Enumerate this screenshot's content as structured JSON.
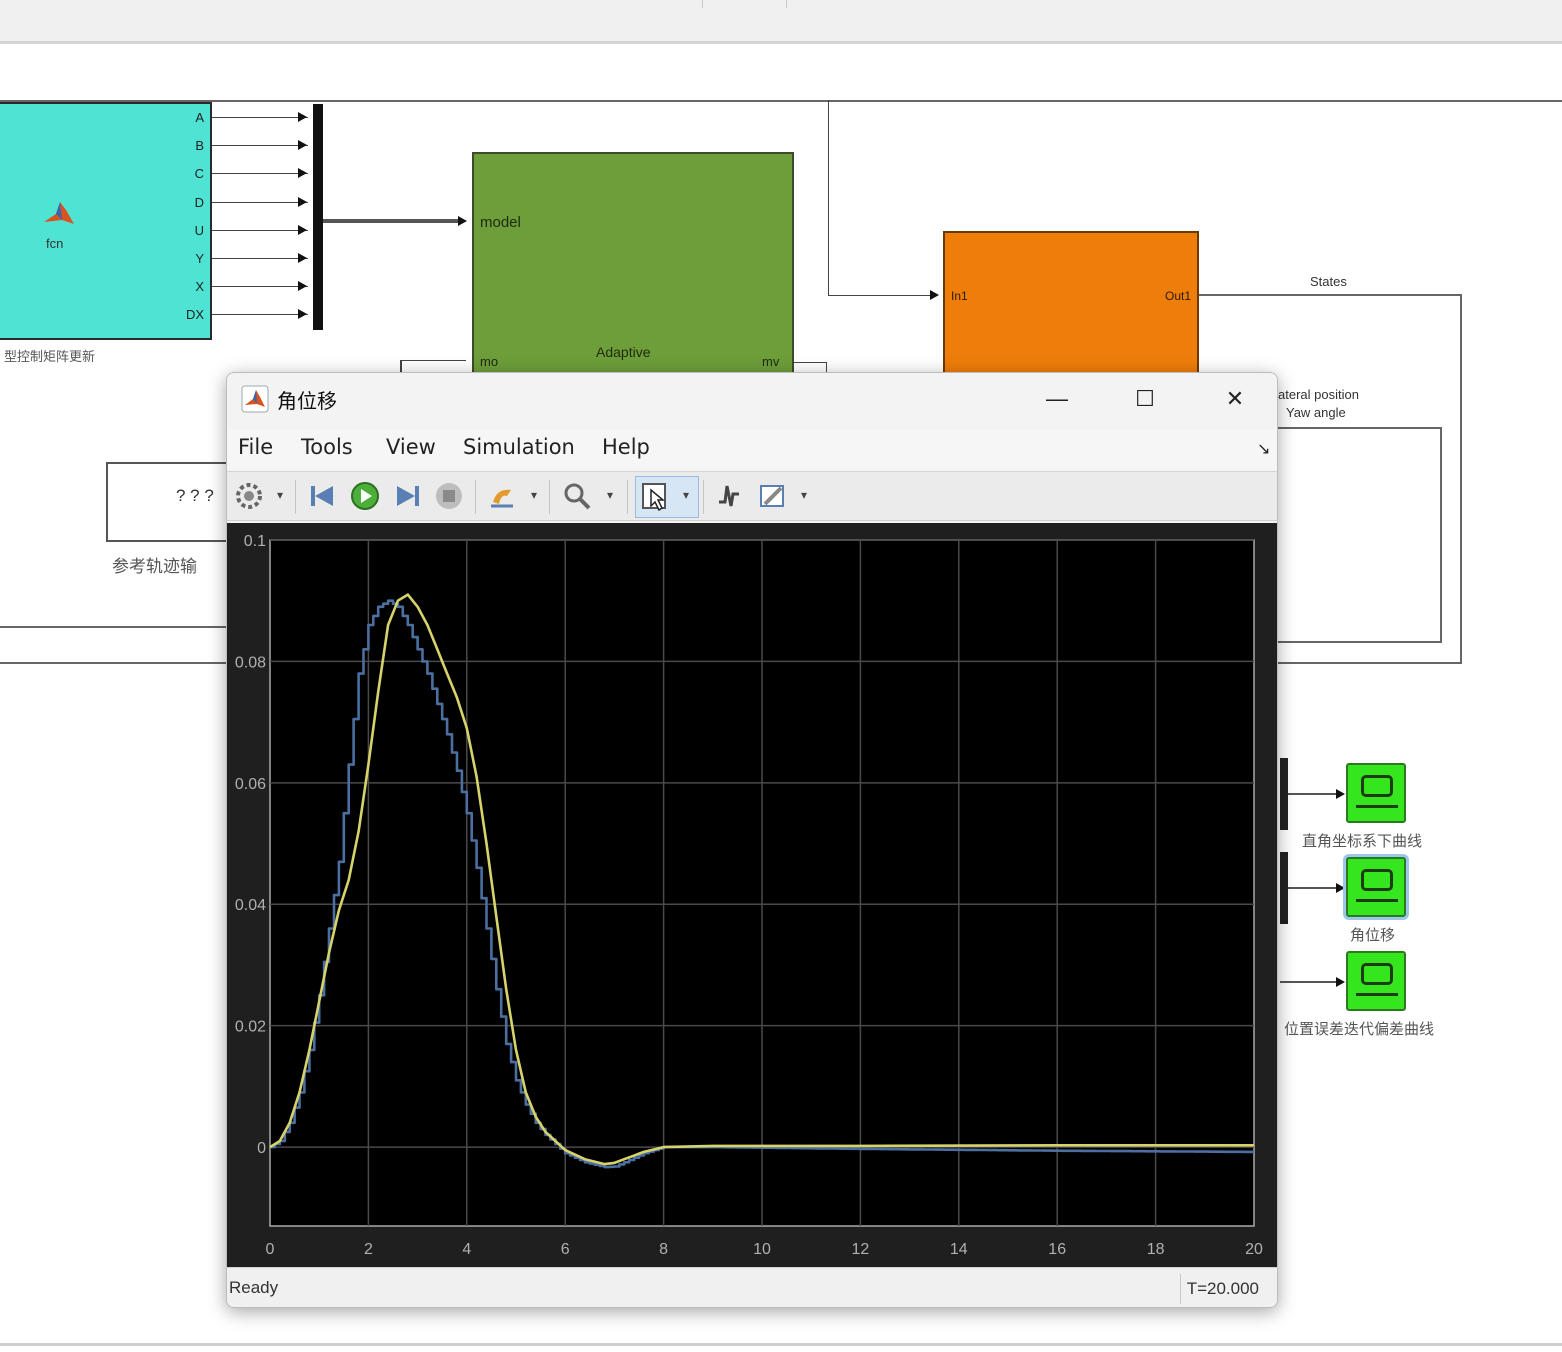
{
  "diagram": {
    "fcn_block": {
      "label": "fcn",
      "ports": [
        "A",
        "B",
        "C",
        "D",
        "U",
        "Y",
        "X",
        "DX"
      ],
      "caption": "型控制矩阵更新"
    },
    "adaptive_block": {
      "input_model": "model",
      "input_mo": "mo",
      "title": "Adaptive",
      "output": "mv"
    },
    "plant_block": {
      "input": "In1",
      "output": "Out1"
    },
    "states_label": "States",
    "lateral_label": "ateral position",
    "yaw_label": "Yaw angle",
    "ref_block_text": "? ? ?",
    "ref_caption": "参考轨迹输",
    "scopes": [
      {
        "caption": "直角坐标系下曲线"
      },
      {
        "caption": "角位移"
      },
      {
        "caption": "位置误差迭代偏差曲线"
      }
    ]
  },
  "window": {
    "title": "角位移",
    "minimize": "—",
    "maximize": "☐",
    "close": "✕",
    "menu": [
      "File",
      "Tools",
      "View",
      "Simulation",
      "Help"
    ],
    "menu_extra": "↘",
    "status": "Ready",
    "time": "T=20.000",
    "toolbar_icons": [
      "settings-icon",
      "step-back-icon",
      "run-icon",
      "step-forward-icon",
      "stop-icon",
      "highlight-icon",
      "zoom-icon",
      "cursor-icon",
      "triggers-icon",
      "style-icon"
    ]
  },
  "colors": {
    "fcn_block": "#4fe3d4",
    "adaptive_block": "#6d9e3a",
    "plant_block": "#ee7d0a",
    "scope_block": "#35e61e",
    "plot_bg": "#000000",
    "series_blue": "#4a6fa0",
    "series_yellow": "#d7d36b"
  },
  "chart_data": {
    "type": "line",
    "xlim": [
      0,
      20
    ],
    "ylim": [
      -0.013,
      0.1
    ],
    "x_ticks": [
      0,
      2,
      4,
      6,
      8,
      10,
      12,
      14,
      16,
      18,
      20
    ],
    "x_tick_labels": [
      "0",
      "2",
      "4",
      "6",
      "8",
      "10",
      "12",
      "14",
      "16",
      "18",
      "20"
    ],
    "y_ticks": [
      0,
      0.02,
      0.04,
      0.06,
      0.08,
      0.1
    ],
    "y_tick_labels": [
      "0",
      "0.02",
      "0.04",
      "0.06",
      "0.08",
      "0.1"
    ],
    "grid": true,
    "series": [
      {
        "color": "#4a6fa0",
        "stairs": true,
        "x": [
          0,
          0.2,
          0.4,
          0.6,
          0.8,
          1.0,
          1.2,
          1.4,
          1.6,
          1.8,
          2.0,
          2.2,
          2.4,
          2.6,
          2.8,
          3.0,
          3.2,
          3.4,
          3.6,
          3.8,
          4.0,
          4.2,
          4.4,
          4.6,
          4.8,
          5.0,
          5.2,
          5.4,
          5.6,
          5.8,
          6.0,
          6.4,
          6.8,
          7.0,
          7.2,
          7.6,
          8.0,
          9.0,
          12.0,
          16.0,
          20.0
        ],
        "y": [
          0,
          0.001,
          0.004,
          0.009,
          0.016,
          0.025,
          0.036,
          0.047,
          0.063,
          0.078,
          0.086,
          0.089,
          0.09,
          0.089,
          0.086,
          0.082,
          0.078,
          0.073,
          0.068,
          0.062,
          0.055,
          0.046,
          0.036,
          0.026,
          0.017,
          0.011,
          0.007,
          0.004,
          0.002,
          0.0005,
          -0.001,
          -0.0025,
          -0.0033,
          -0.0032,
          -0.0025,
          -0.001,
          0,
          0,
          -0.0003,
          -0.0006,
          -0.0008
        ]
      },
      {
        "color": "#d7d36b",
        "stairs": false,
        "x": [
          0,
          0.2,
          0.4,
          0.6,
          0.8,
          1.0,
          1.2,
          1.4,
          1.6,
          1.8,
          2.0,
          2.2,
          2.4,
          2.6,
          2.8,
          3.0,
          3.2,
          3.4,
          3.6,
          3.8,
          4.0,
          4.2,
          4.4,
          4.6,
          4.8,
          5.0,
          5.2,
          5.4,
          5.6,
          5.8,
          6.0,
          6.4,
          6.8,
          7.0,
          7.2,
          7.6,
          8.0,
          9.0,
          12.0,
          16.0,
          20.0
        ],
        "y": [
          0,
          0.001,
          0.004,
          0.009,
          0.016,
          0.024,
          0.032,
          0.039,
          0.044,
          0.052,
          0.063,
          0.075,
          0.086,
          0.09,
          0.091,
          0.089,
          0.086,
          0.082,
          0.078,
          0.074,
          0.069,
          0.061,
          0.05,
          0.038,
          0.026,
          0.016,
          0.009,
          0.005,
          0.0025,
          0.001,
          -0.0005,
          -0.002,
          -0.0028,
          -0.0026,
          -0.002,
          -0.0008,
          0,
          0.0002,
          0.0002,
          0.0003,
          0.0003
        ]
      }
    ]
  }
}
